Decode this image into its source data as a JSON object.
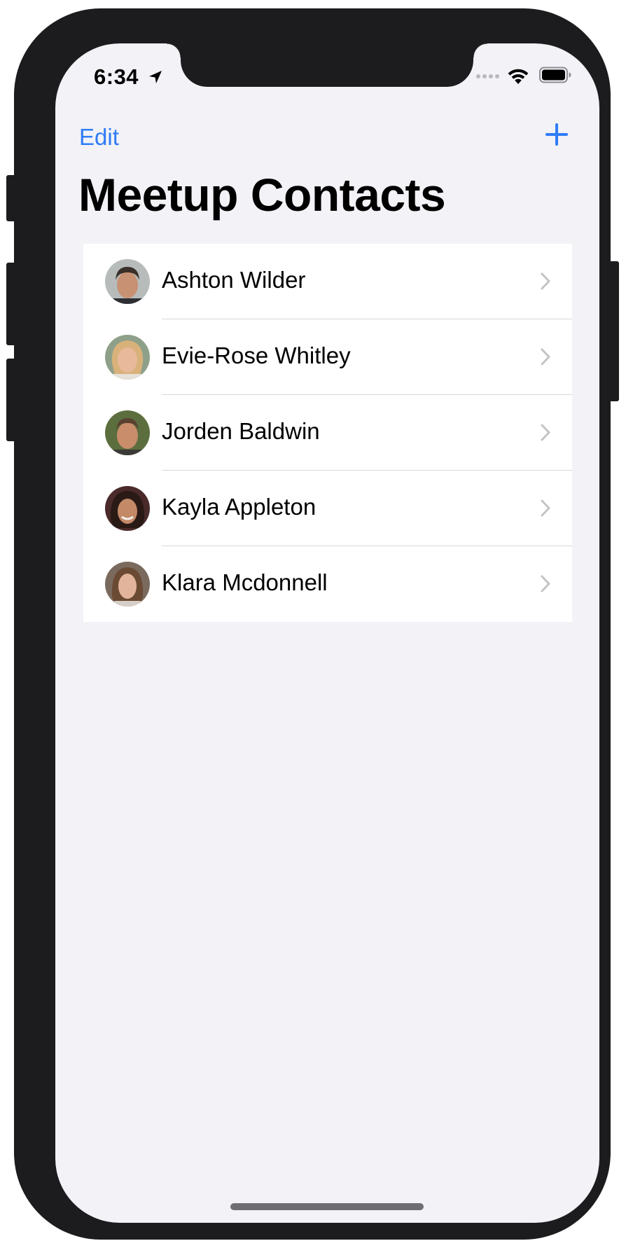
{
  "status_bar": {
    "time": "6:34",
    "location_icon": "location-arrow-icon",
    "wifi_icon": "wifi-icon",
    "battery_icon": "battery-icon"
  },
  "nav": {
    "edit_label": "Edit",
    "add_icon": "plus-icon"
  },
  "title": "Meetup Contacts",
  "contacts": [
    {
      "name": "Ashton Wilder",
      "avatar": "avatar-photo",
      "chevron": "chevron-right-icon"
    },
    {
      "name": "Evie-Rose Whitley",
      "avatar": "avatar-photo",
      "chevron": "chevron-right-icon"
    },
    {
      "name": "Jorden Baldwin",
      "avatar": "avatar-photo",
      "chevron": "chevron-right-icon"
    },
    {
      "name": "Kayla Appleton",
      "avatar": "avatar-photo",
      "chevron": "chevron-right-icon"
    },
    {
      "name": "Klara Mcdonnell",
      "avatar": "avatar-photo",
      "chevron": "chevron-right-icon"
    }
  ],
  "colors": {
    "accent": "#2f7cf6",
    "background": "#f2f2f7",
    "frame": "#1c1c1e",
    "chevron": "#c4c4c7",
    "separator": "#d8d8dc"
  }
}
